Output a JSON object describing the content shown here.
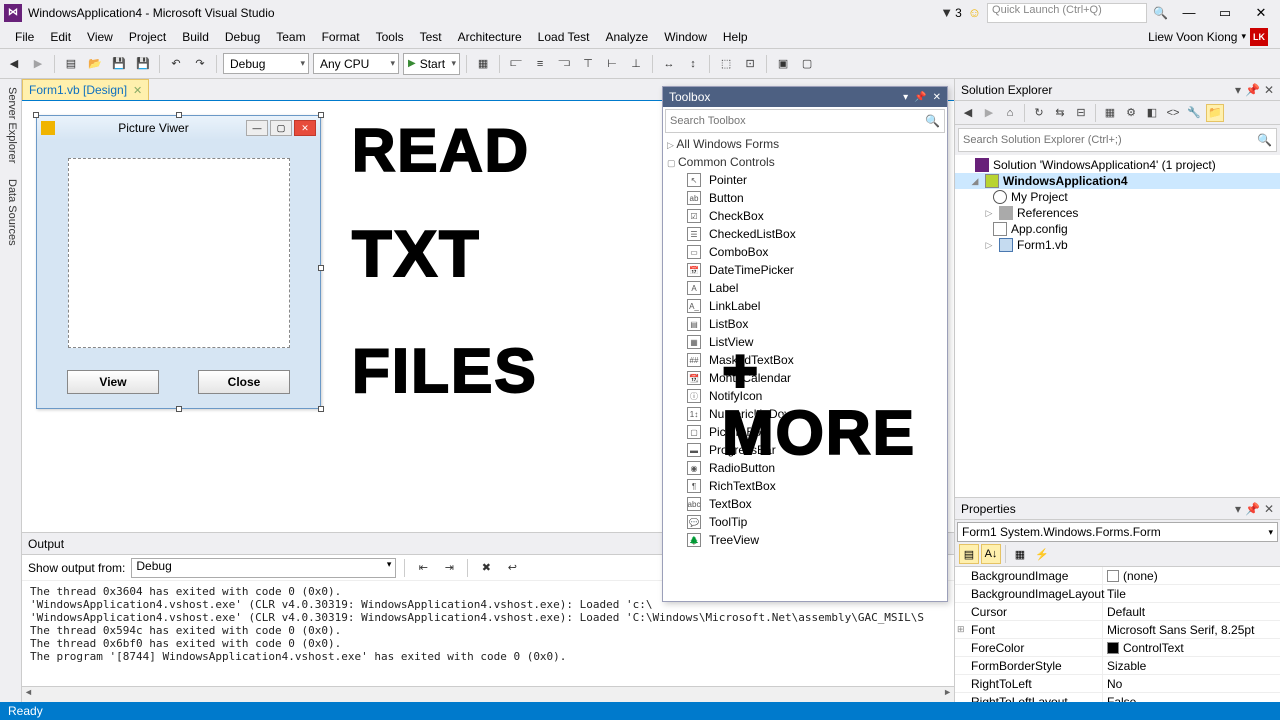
{
  "title": "WindowsApplication4 - Microsoft Visual Studio",
  "notif_count": "3",
  "quick_launch_placeholder": "Quick Launch (Ctrl+Q)",
  "user": {
    "name": "Liew Voon Kiong",
    "initials": "LK"
  },
  "menu": [
    "File",
    "Edit",
    "View",
    "Project",
    "Build",
    "Debug",
    "Team",
    "Format",
    "Tools",
    "Test",
    "Architecture",
    "Load Test",
    "Analyze",
    "Window",
    "Help"
  ],
  "toolbar": {
    "config": "Debug",
    "platform": "Any CPU",
    "start": "Start"
  },
  "side_tabs": [
    "Server Explorer",
    "Data Sources"
  ],
  "doc_tab": "Form1.vb [Design]",
  "form": {
    "caption": "Picture Viwer",
    "btn_view": "View",
    "btn_close": "Close"
  },
  "overlay": {
    "l1": "READ",
    "l2": "TXT",
    "l3": "FILES",
    "l4": "+ MORE"
  },
  "output": {
    "title": "Output",
    "show_from_label": "Show output from:",
    "show_from_value": "Debug",
    "lines": [
      "The thread 0x3604 has exited with code 0 (0x0).",
      "'WindowsApplication4.vshost.exe' (CLR v4.0.30319: WindowsApplication4.vshost.exe): Loaded 'c:\\",
      "'WindowsApplication4.vshost.exe' (CLR v4.0.30319: WindowsApplication4.vshost.exe): Loaded 'C:\\Windows\\Microsoft.Net\\assembly\\GAC_MSIL\\S",
      "The thread 0x594c has exited with code 0 (0x0).",
      "The thread 0x6bf0 has exited with code 0 (0x0).",
      "The program '[8744] WindowsApplication4.vshost.exe' has exited with code 0 (0x0)."
    ]
  },
  "toolbox": {
    "title": "Toolbox",
    "search_placeholder": "Search Toolbox",
    "group_all": "All Windows Forms",
    "group_common": "Common Controls",
    "items": [
      "Pointer",
      "Button",
      "CheckBox",
      "CheckedListBox",
      "ComboBox",
      "DateTimePicker",
      "Label",
      "LinkLabel",
      "ListBox",
      "ListView",
      "MaskedTextBox",
      "MonthCalendar",
      "NotifyIcon",
      "NumericUpDown",
      "PictureBox",
      "ProgressBar",
      "RadioButton",
      "RichTextBox",
      "TextBox",
      "ToolTip",
      "TreeView"
    ],
    "icons": [
      "↖",
      "ab",
      "☑",
      "☰",
      "▭",
      "📅",
      "A",
      "A_",
      "▤",
      "▦",
      "##",
      "📆",
      "ⓘ",
      "1↕",
      "▢",
      "▬",
      "◉",
      "¶",
      "abc",
      "💬",
      "🌲"
    ]
  },
  "solexp": {
    "title": "Solution Explorer",
    "search_placeholder": "Search Solution Explorer (Ctrl+;)",
    "solution": "Solution 'WindowsApplication4' (1 project)",
    "project": "WindowsApplication4",
    "nodes": [
      "My Project",
      "References",
      "App.config",
      "Form1.vb"
    ]
  },
  "props": {
    "title": "Properties",
    "object": "Form1 System.Windows.Forms.Form",
    "rows": [
      {
        "n": "BackgroundImage",
        "v": "(none)",
        "sw": "#fff",
        "exp": ""
      },
      {
        "n": "BackgroundImageLayout",
        "v": "Tile"
      },
      {
        "n": "Cursor",
        "v": "Default"
      },
      {
        "n": "Font",
        "v": "Microsoft Sans Serif, 8.25pt",
        "exp": "⊞"
      },
      {
        "n": "ForeColor",
        "v": "ControlText",
        "sw": "#000"
      },
      {
        "n": "FormBorderStyle",
        "v": "Sizable"
      },
      {
        "n": "RightToLeft",
        "v": "No"
      },
      {
        "n": "RightToLeftLayout",
        "v": "False"
      }
    ]
  },
  "status": "Ready"
}
